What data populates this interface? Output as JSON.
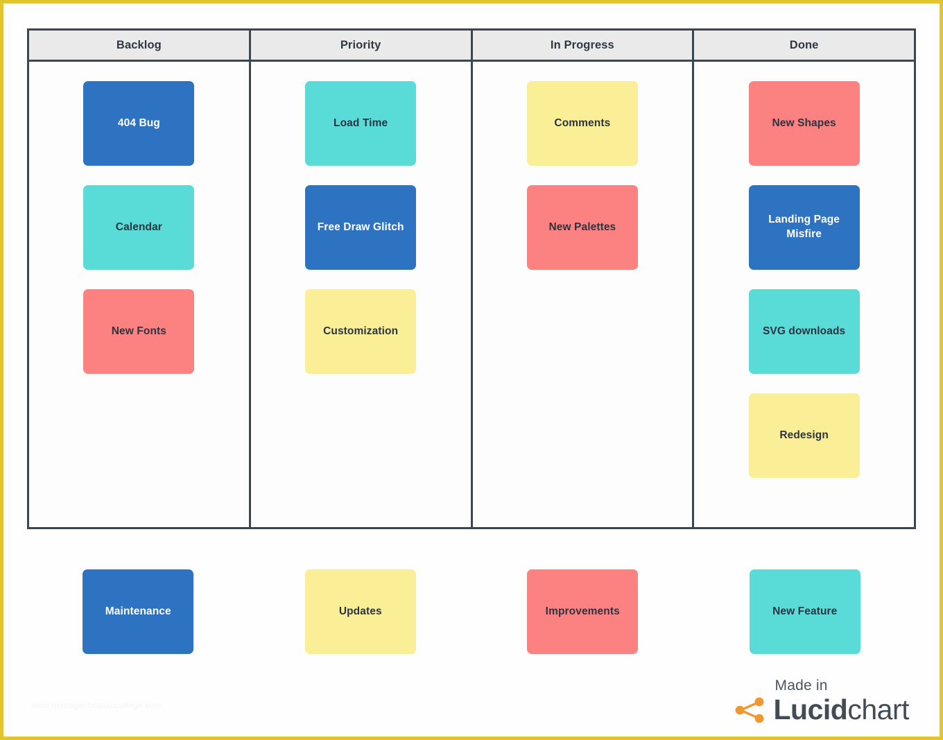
{
  "board": {
    "columns": [
      {
        "header": "Backlog",
        "cards": [
          {
            "label": "404 Bug",
            "color": "blue"
          },
          {
            "label": "Calendar",
            "color": "teal"
          },
          {
            "label": "New Fonts",
            "color": "salmon"
          }
        ]
      },
      {
        "header": "Priority",
        "cards": [
          {
            "label": "Load Time",
            "color": "teal"
          },
          {
            "label": "Free Draw Glitch",
            "color": "blue"
          },
          {
            "label": "Customization",
            "color": "yellow"
          }
        ]
      },
      {
        "header": "In Progress",
        "cards": [
          {
            "label": "Comments",
            "color": "yellow"
          },
          {
            "label": "New Palettes",
            "color": "salmon"
          }
        ]
      },
      {
        "header": "Done",
        "cards": [
          {
            "label": "New Shapes",
            "color": "salmon"
          },
          {
            "label": "Landing Page Misfire",
            "color": "blue"
          },
          {
            "label": "SVG downloads",
            "color": "teal"
          },
          {
            "label": "Redesign",
            "color": "yellow"
          }
        ]
      }
    ]
  },
  "legend": [
    {
      "label": "Maintenance",
      "color": "blue"
    },
    {
      "label": "Updates",
      "color": "yellow"
    },
    {
      "label": "Improvements",
      "color": "salmon"
    },
    {
      "label": "New Feature",
      "color": "teal"
    }
  ],
  "logo": {
    "made_in": "Made in",
    "brand_bold": "Lucid",
    "brand_light": "chart",
    "mark_icon": "lucid-node-icon",
    "mark_color": "#F2962F"
  },
  "watermark": "www.heritagechristiancollege.com",
  "colors": {
    "blue": "#2E73C2",
    "teal": "#59DBD8",
    "salmon": "#FB8281",
    "yellow": "#FAEF96",
    "border": "#3C4650",
    "header_bg": "#EAEAEA",
    "page_border": "#E0C52E"
  }
}
